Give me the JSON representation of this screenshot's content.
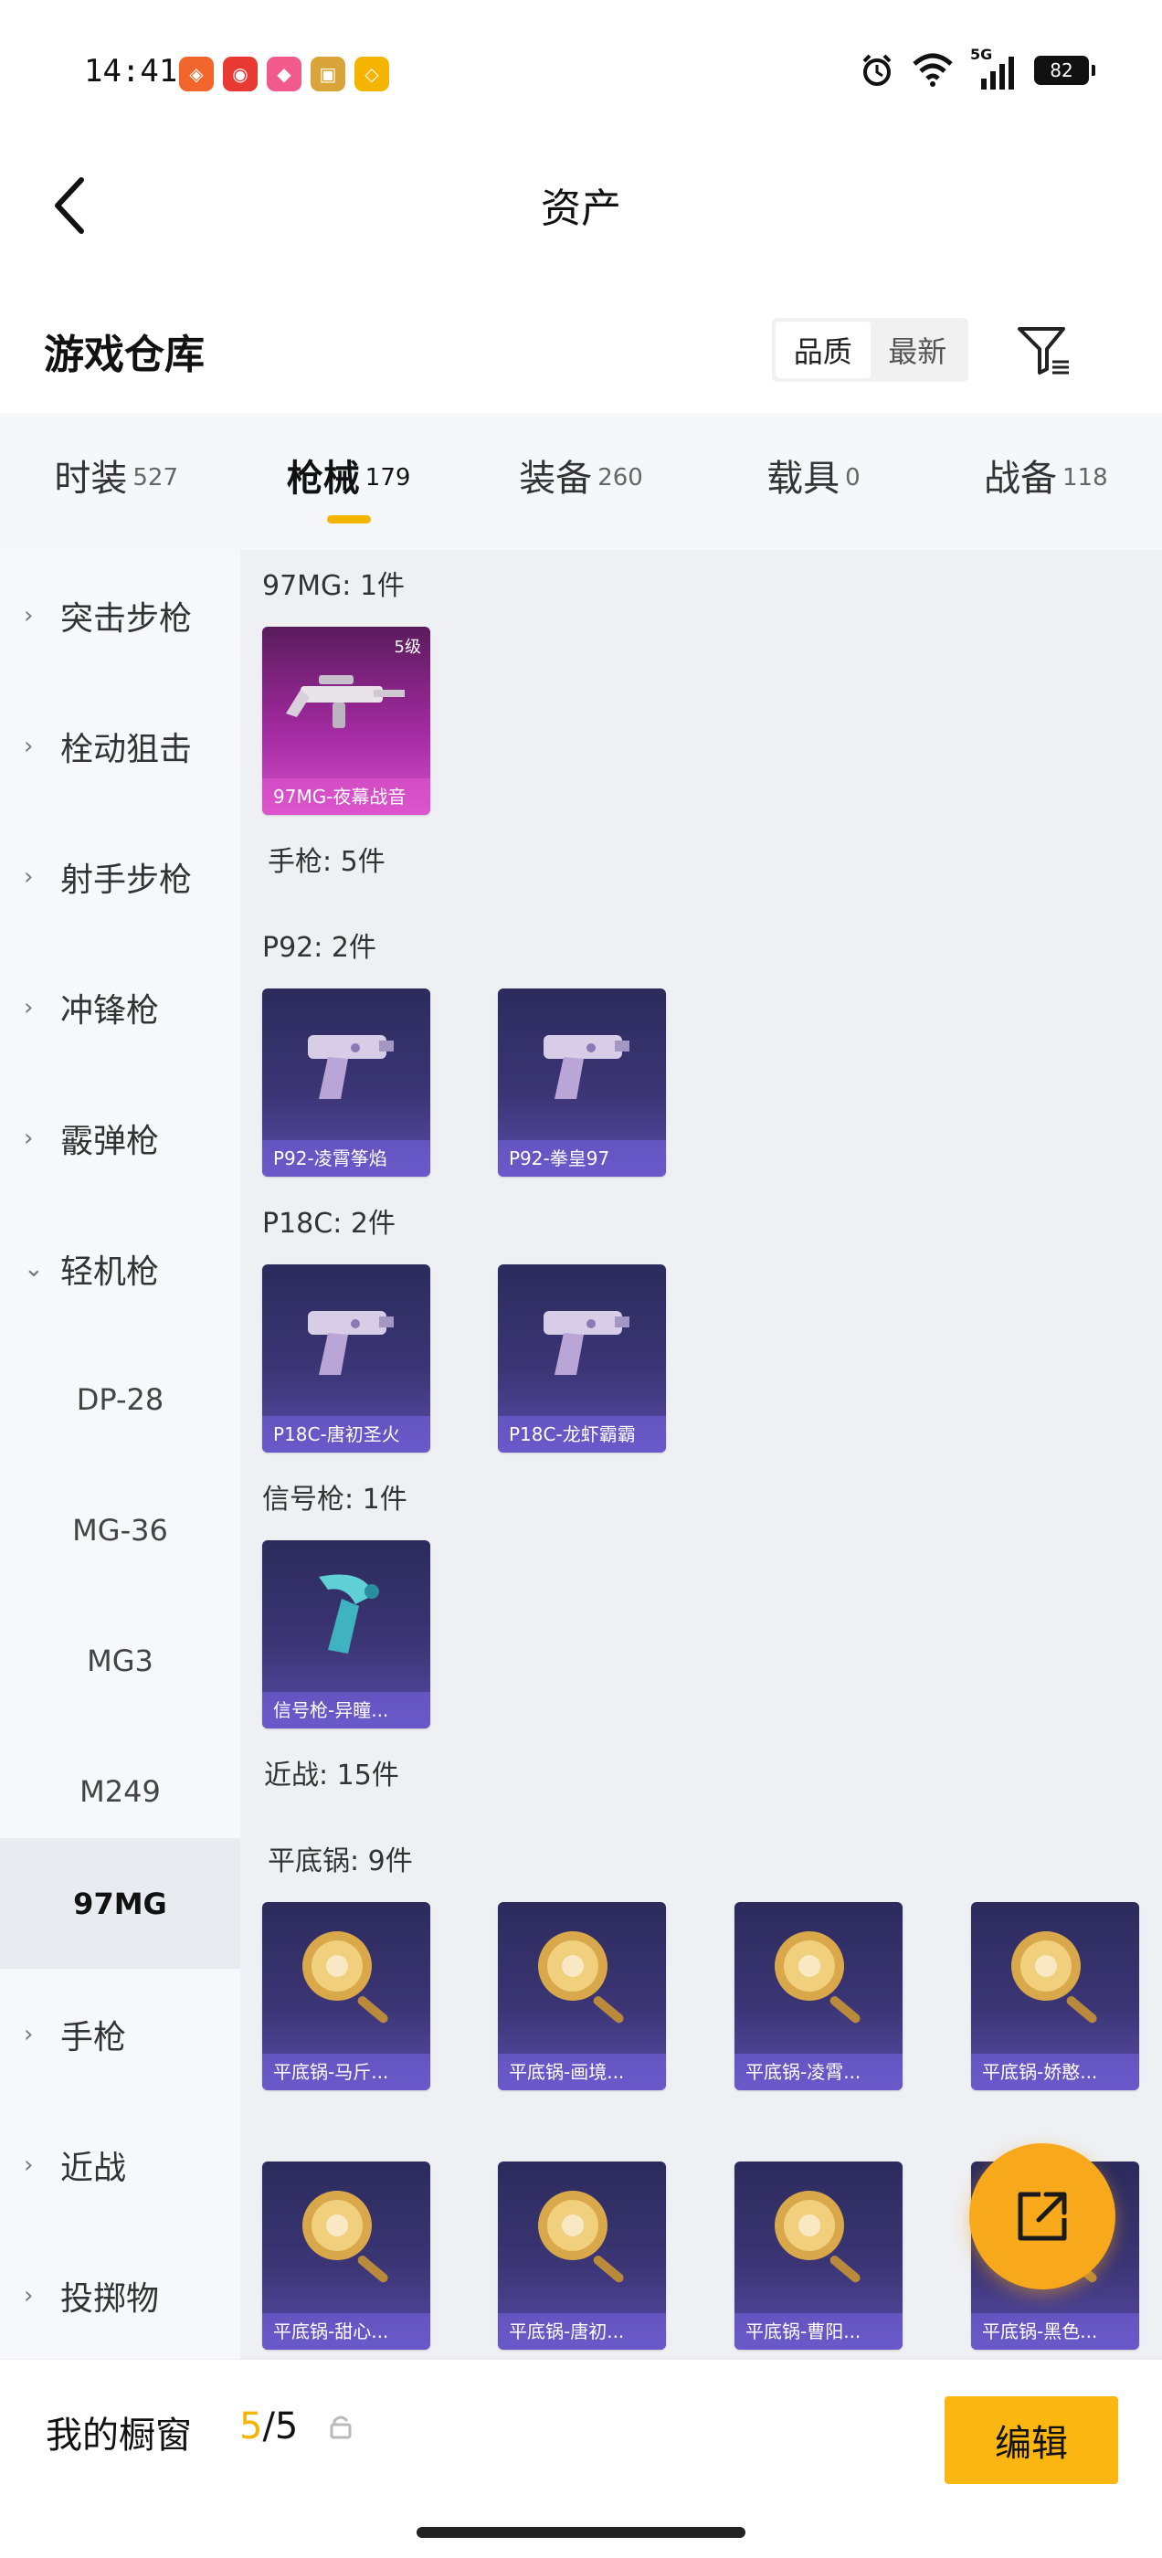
{
  "status_bar": {
    "time": "14:41",
    "apps": [
      {
        "icon": "app-icon-1",
        "color": "#f3662b",
        "glyph": "◈"
      },
      {
        "icon": "app-icon-netease-music",
        "color": "#e83a33",
        "glyph": "◉"
      },
      {
        "icon": "app-icon-3",
        "color": "#f25a8b",
        "glyph": "◆"
      },
      {
        "icon": "app-icon-4",
        "color": "#d9a43a",
        "glyph": "▣"
      },
      {
        "icon": "app-icon-5",
        "color": "#f5b400",
        "glyph": "◇"
      }
    ],
    "network": "5G",
    "battery": "82"
  },
  "nav": {
    "title": "资产"
  },
  "repo": {
    "title": "游戏仓库",
    "sort_options": [
      {
        "label": "品质",
        "active": true
      },
      {
        "label": "最新",
        "active": false
      }
    ]
  },
  "tabs": [
    {
      "label": "时装",
      "count": "527",
      "active": false
    },
    {
      "label": "枪械",
      "count": "179",
      "active": true
    },
    {
      "label": "装备",
      "count": "260",
      "active": false
    },
    {
      "label": "载具",
      "count": "0",
      "active": false
    },
    {
      "label": "战备",
      "count": "118",
      "active": false
    }
  ],
  "sidebar": [
    {
      "label": "突击步枪",
      "chevron": "right",
      "type": "main"
    },
    {
      "label": "栓动狙击",
      "chevron": "right",
      "type": "main"
    },
    {
      "label": "射手步枪",
      "chevron": "right",
      "type": "main"
    },
    {
      "label": "冲锋枪",
      "chevron": "right",
      "type": "main"
    },
    {
      "label": "霰弹枪",
      "chevron": "right",
      "type": "main"
    },
    {
      "label": "轻机枪",
      "chevron": "down",
      "type": "main"
    },
    {
      "label": "DP-28",
      "type": "sub"
    },
    {
      "label": "MG-36",
      "type": "sub"
    },
    {
      "label": "MG3",
      "type": "sub"
    },
    {
      "label": "M249",
      "type": "sub"
    },
    {
      "label": "97MG",
      "type": "sub",
      "selected": true
    },
    {
      "label": "手枪",
      "chevron": "right",
      "type": "main"
    },
    {
      "label": "近战",
      "chevron": "right",
      "type": "main"
    },
    {
      "label": "投掷物",
      "chevron": "right",
      "type": "main"
    }
  ],
  "content": {
    "sections": [
      {
        "label": "97MG: 1件"
      },
      {
        "label": "手枪: 5件"
      },
      {
        "label": "P92: 2件"
      },
      {
        "label": "P18C: 2件"
      },
      {
        "label": "信号枪: 1件"
      },
      {
        "label": "近战: 15件"
      },
      {
        "label": "平底锅: 9件"
      }
    ],
    "cards": [
      {
        "name": "97MG-夜幕战音",
        "level": "5级",
        "variant": "pink",
        "art": "gun"
      },
      {
        "name": "P92-凌霄筝焰",
        "variant": "purple",
        "art": "pistol"
      },
      {
        "name": "P92-拳皇97",
        "variant": "purple",
        "art": "pistol"
      },
      {
        "name": "P18C-唐初圣火",
        "variant": "purple",
        "art": "pistol"
      },
      {
        "name": "P18C-龙虾霸霸",
        "variant": "purple",
        "art": "pistol"
      },
      {
        "name": "信号枪-异瞳...",
        "variant": "purple",
        "art": "flare"
      },
      {
        "name": "平底锅-马斤...",
        "variant": "purple",
        "art": "pan"
      },
      {
        "name": "平底锅-画境...",
        "variant": "purple",
        "art": "pan"
      },
      {
        "name": "平底锅-凌霄...",
        "variant": "purple",
        "art": "pan"
      },
      {
        "name": "平底锅-娇憨...",
        "variant": "purple",
        "art": "pan"
      },
      {
        "name": "平底锅-甜心...",
        "variant": "purple",
        "art": "pan"
      },
      {
        "name": "平底锅-唐初...",
        "variant": "purple",
        "art": "pan"
      },
      {
        "name": "平底锅-曹阳...",
        "variant": "purple",
        "art": "pan"
      },
      {
        "name": "平底锅-黑色...",
        "variant": "purple",
        "art": "pan"
      }
    ]
  },
  "bottom": {
    "showcase_label": "我的橱窗",
    "count_current": "5",
    "count_total": "/5",
    "edit_label": "编辑"
  },
  "colors": {
    "accent": "#f5b400",
    "fab": "#f7a91b",
    "card_purple": "#3b3575",
    "card_pink": "#a22aa0"
  }
}
